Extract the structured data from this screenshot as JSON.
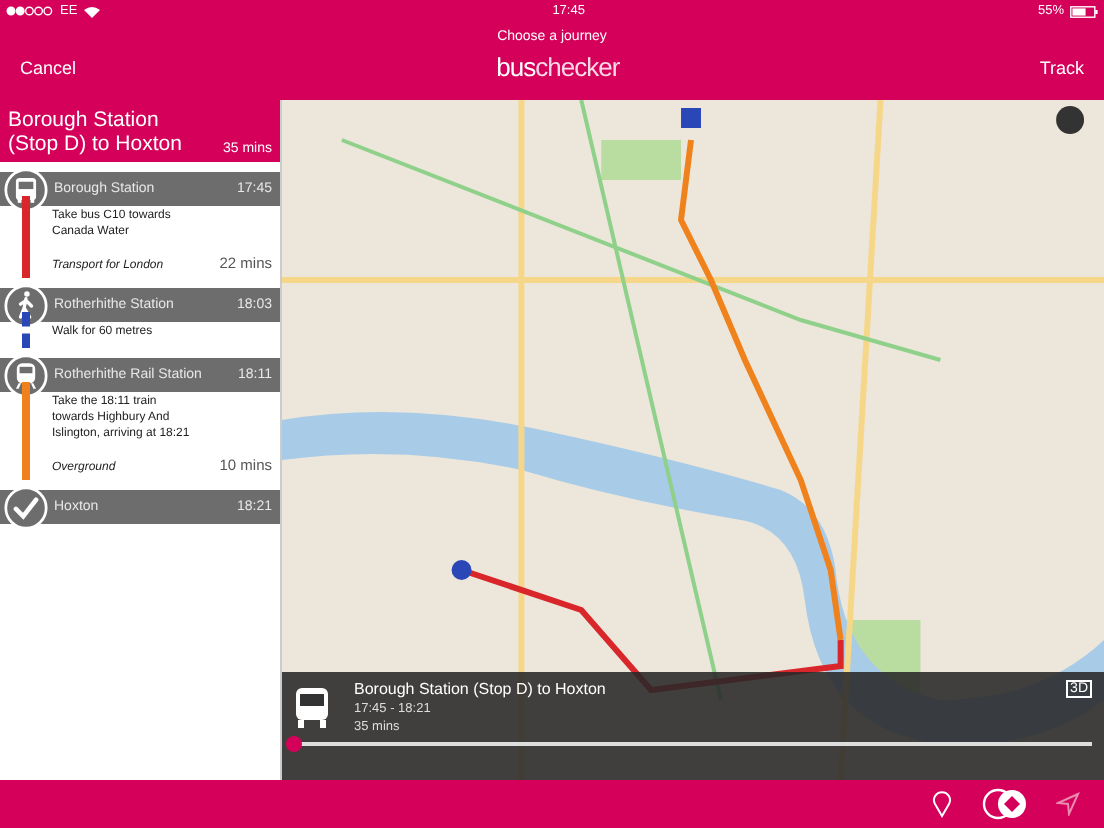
{
  "status_bar": {
    "carrier": "EE",
    "time": "17:45",
    "battery": "55%"
  },
  "nav": {
    "subtitle": "Choose a journey",
    "left": "Cancel",
    "logo_bold": "bus",
    "logo_light": "checker",
    "right": "Track"
  },
  "journey": {
    "title": "Borough Station (Stop D) to Hoxton",
    "duration": "35 mins"
  },
  "legs": [
    {
      "kind": "bus",
      "name": "Borough Station",
      "time": "17:45"
    },
    {
      "kind": "ride",
      "color": "#d9262b",
      "instruction": "Take bus C10 towards Canada Water",
      "operator": "Transport for London",
      "duration": "22 mins"
    },
    {
      "kind": "foot",
      "name": "Rotherhithe Station",
      "time": "18:03"
    },
    {
      "kind": "walkway",
      "color": "#2a47b8",
      "instruction": "Walk for 60 metres"
    },
    {
      "kind": "rail",
      "name": "Rotherhithe Rail Station",
      "time": "18:11"
    },
    {
      "kind": "ride",
      "color": "#f0821e",
      "instruction": "Take the 18:11 train towards Highbury And Islington, arriving at 18:21",
      "operator": "Overground",
      "duration": "10 mins"
    },
    {
      "kind": "arrival",
      "name": "Hoxton",
      "time": "18:21"
    }
  ],
  "overlay": {
    "title": "Borough Station (Stop D) to Hoxton",
    "times": "17:45 - 18:21",
    "duration": "35 mins",
    "mode_button": "3D",
    "progress": {
      "level": 0
    }
  }
}
